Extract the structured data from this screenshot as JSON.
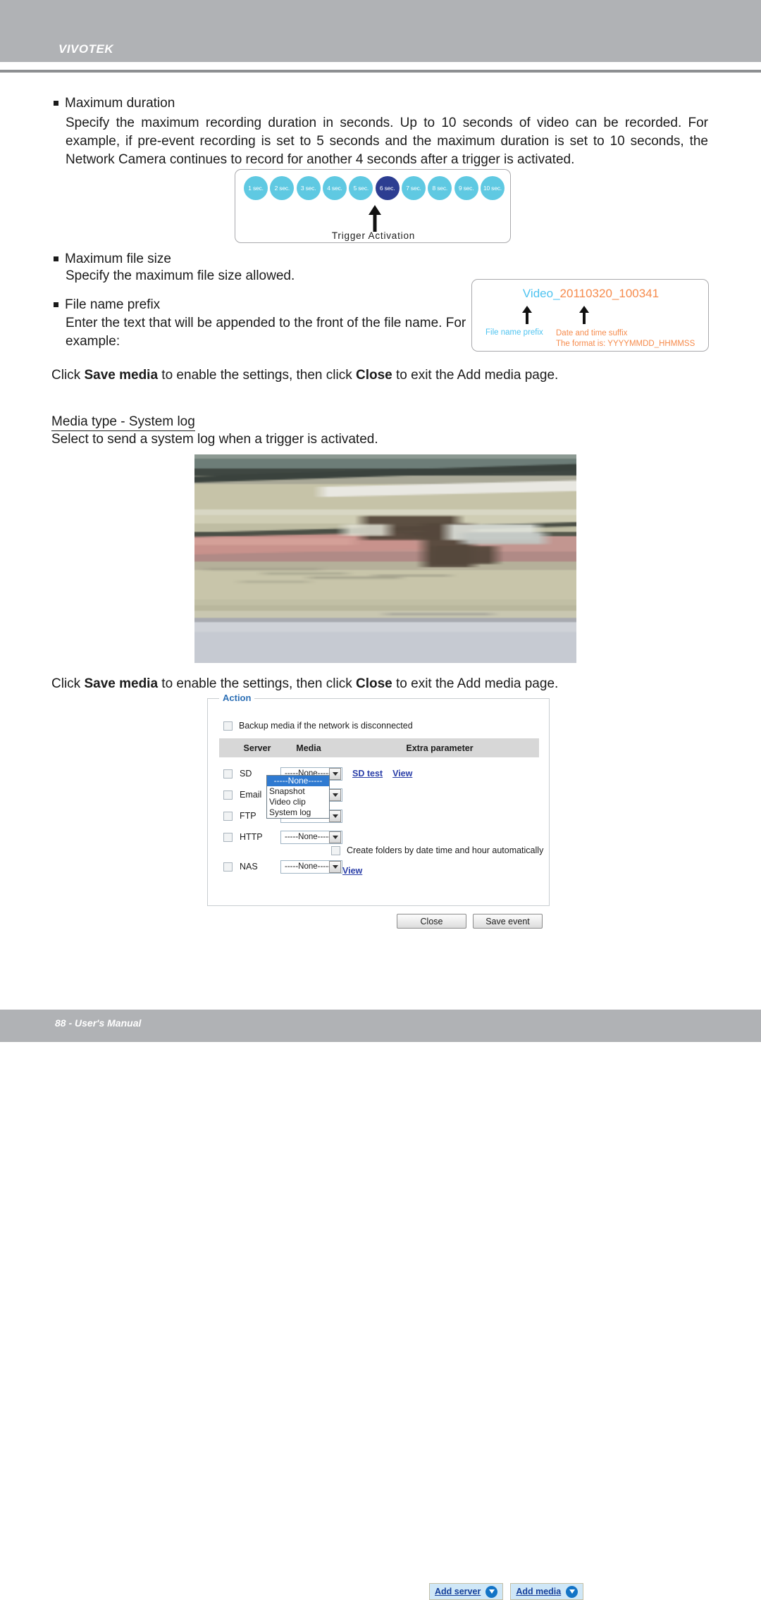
{
  "header": {
    "brand": "VIVOTEK"
  },
  "footer": {
    "page_label": "88 - User's Manual"
  },
  "sections": [
    {
      "heading": "Maximum duration",
      "body": "Specify the maximum recording duration in seconds. Up to 10 seconds of video can be recorded. For example, if pre-event recording is set to 5 seconds and the maximum duration is set to 10 seconds, the Network Camera continues to record for another 4 seconds after a trigger is activated."
    },
    {
      "heading": "Maximum file size",
      "body": "Specify the maximum file size allowed."
    },
    {
      "heading": "File name prefix",
      "body": "Enter the text that will be appended to the front of the file name. For example:"
    }
  ],
  "instructions": {
    "save_media_line_1_pre": "Click ",
    "save_media_bold_1": "Save media",
    "save_media_line_1_mid": " to enable the settings, then click ",
    "save_media_bold_2": "Close",
    "save_media_line_1_post": " to exit the Add media page."
  },
  "media_type_section": {
    "heading": "Media type - System log",
    "description": "Select to send a system log when a trigger is activated."
  },
  "timeline_diagram": {
    "circles": [
      {
        "label": "1 sec.",
        "active": false
      },
      {
        "label": "2 sec.",
        "active": false
      },
      {
        "label": "3 sec.",
        "active": false
      },
      {
        "label": "4 sec.",
        "active": false
      },
      {
        "label": "5 sec.",
        "active": false
      },
      {
        "label": "6 sec.",
        "active": true
      },
      {
        "label": "7 sec.",
        "active": false
      },
      {
        "label": "8 sec.",
        "active": false
      },
      {
        "label": "9 sec.",
        "active": false
      },
      {
        "label": "10 sec.",
        "active": false
      }
    ],
    "trigger_label": "Trigger Activation",
    "colors": {
      "inactive": "#5fc9e2",
      "active": "#2c3d91"
    }
  },
  "filename_example": {
    "prefix": "Video_",
    "suffix": "20110320_100341",
    "prefix_label": "File name prefix",
    "suffix_label_line1": "Date and time suffix",
    "suffix_label_line2": "The format is: YYYYMMDD_HHMMSS",
    "colors": {
      "prefix": "#4ec3f0",
      "suffix": "#f68b4c"
    }
  },
  "action_panel": {
    "legend": "Action",
    "backup_checkbox_label": "Backup media if the network is disconnected",
    "table_headers": [
      "",
      "Server",
      "Media",
      "Extra parameter"
    ],
    "rows": [
      {
        "server": "SD",
        "media": "-----None-----",
        "links": [
          "SD test",
          "View"
        ]
      },
      {
        "server": "Email",
        "media": "-----None-----",
        "links": []
      },
      {
        "server": "FTP",
        "media": "-----None-----",
        "links": []
      },
      {
        "server": "HTTP",
        "media": "-----None-----",
        "links": []
      },
      {
        "server": "NAS",
        "media": "-----None-----",
        "links": [
          "View"
        ]
      }
    ],
    "media_dropdown_options": [
      "-----None-----",
      "Snapshot",
      "Video clip",
      "System log"
    ],
    "media_dropdown_selected": "-----None-----",
    "nas_checkbox_label": "Create folders by date time and hour automatically",
    "add_server_label": "Add server",
    "add_media_label": "Add media",
    "legend_color": "#2c6fb5"
  },
  "bottom_buttons": {
    "close": "Close",
    "save_event": "Save event"
  }
}
